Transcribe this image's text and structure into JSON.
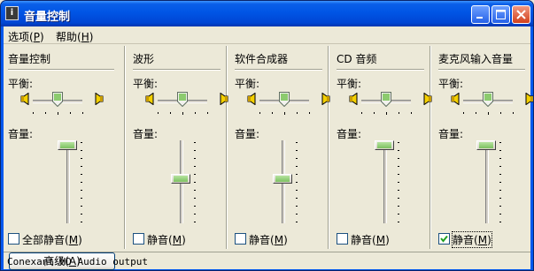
{
  "window": {
    "title": "音量控制",
    "app_icon_char": "i"
  },
  "menu": [
    {
      "label": "选项",
      "accel": "P"
    },
    {
      "label": "帮助",
      "accel": "H"
    }
  ],
  "labels": {
    "balance": "平衡:",
    "volume": "音量:"
  },
  "columns": [
    {
      "id": "master",
      "title": "音量控制",
      "balance_position": 0.5,
      "volume_level": 1.0,
      "mute_label": "全部静音",
      "mute_accel": "M",
      "muted": false,
      "advanced_label": "高级",
      "advanced_accel": "A"
    },
    {
      "id": "wave",
      "title": "波形",
      "balance_position": 0.5,
      "volume_level": 0.5,
      "mute_label": "静音",
      "mute_accel": "M",
      "muted": false
    },
    {
      "id": "synth",
      "title": "软件合成器",
      "balance_position": 0.5,
      "volume_level": 0.5,
      "mute_label": "静音",
      "mute_accel": "M",
      "muted": false
    },
    {
      "id": "cd",
      "title": "CD 音频",
      "balance_position": 0.5,
      "volume_level": 1.0,
      "mute_label": "静音",
      "mute_accel": "M",
      "muted": false
    },
    {
      "id": "mic",
      "title": "麦克风输入音量",
      "balance_position": 0.5,
      "volume_level": 1.0,
      "mute_label": "静音",
      "mute_accel": "M",
      "muted": true
    }
  ],
  "status": "Conexant HD Audio output",
  "colors": {
    "titlebar": "#0055E5",
    "face": "#ECE9D8",
    "thumb_accent": "#7CC060"
  }
}
